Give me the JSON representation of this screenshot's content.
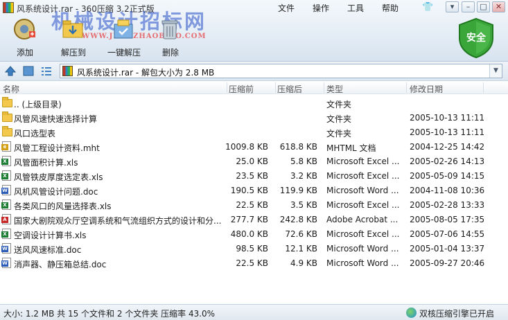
{
  "window": {
    "title": "风系统设计.rar - 360压缩 3.2正式版"
  },
  "menu": [
    "文件",
    "操作",
    "工具",
    "帮助"
  ],
  "watermark": {
    "text": "机械设计招标网",
    "url": "WWW.JIXIEZHAOBIAO.COM"
  },
  "toolbar": {
    "add": "添加",
    "extract_to": "解压到",
    "one_click_extract": "一键解压",
    "delete": "删除",
    "safe": "安全"
  },
  "address": {
    "path": "风系统设计.rar - 解包大小为 2.8 MB"
  },
  "columns": {
    "name": "名称",
    "size": "压缩前",
    "packed": "压缩后",
    "type": "类型",
    "date": "修改日期"
  },
  "files": [
    {
      "name": ".. (上级目录)",
      "size": "",
      "packed": "",
      "type": "文件夹",
      "date": "",
      "icon": "folder-icon"
    },
    {
      "name": "风管风速快速选择计算",
      "size": "",
      "packed": "",
      "type": "文件夹",
      "date": "2005-10-13 11:11",
      "icon": "folder-icon"
    },
    {
      "name": "风口选型表",
      "size": "",
      "packed": "",
      "type": "文件夹",
      "date": "2005-10-13 11:11",
      "icon": "folder-icon"
    },
    {
      "name": "风管工程设计资料.mht",
      "size": "1009.8 KB",
      "packed": "618.8 KB",
      "type": "MHTML 文档",
      "date": "2004-12-25 14:42",
      "icon": "mht-file-icon"
    },
    {
      "name": "风管面积计算.xls",
      "size": "25.0 KB",
      "packed": "5.8 KB",
      "type": "Microsoft Excel ...",
      "date": "2005-02-26 14:13",
      "icon": "excel-file-icon"
    },
    {
      "name": "风管铁皮厚度选定表.xls",
      "size": "23.5 KB",
      "packed": "3.2 KB",
      "type": "Microsoft Excel ...",
      "date": "2005-05-09 14:15",
      "icon": "excel-file-icon"
    },
    {
      "name": "风机风管设计问题.doc",
      "size": "190.5 KB",
      "packed": "119.9 KB",
      "type": "Microsoft Word ...",
      "date": "2004-11-08 10:36",
      "icon": "word-file-icon"
    },
    {
      "name": "各类风口的风量选择表.xls",
      "size": "22.5 KB",
      "packed": "3.5 KB",
      "type": "Microsoft Excel ...",
      "date": "2005-02-28 13:33",
      "icon": "excel-file-icon"
    },
    {
      "name": "国家大剧院观众厅空调系统和气流组织方式的设计和分...",
      "size": "277.7 KB",
      "packed": "242.8 KB",
      "type": "Adobe Acrobat ...",
      "date": "2005-08-05 17:35",
      "icon": "pdf-file-icon"
    },
    {
      "name": "空调设计计算书.xls",
      "size": "480.0 KB",
      "packed": "72.6 KB",
      "type": "Microsoft Excel ...",
      "date": "2005-07-06 14:55",
      "icon": "excel-file-icon"
    },
    {
      "name": "送风风速标准.doc",
      "size": "98.5 KB",
      "packed": "12.1 KB",
      "type": "Microsoft Word ...",
      "date": "2005-01-04 13:37",
      "icon": "word-file-icon"
    },
    {
      "name": "消声器、静压箱总结.doc",
      "size": "22.5 KB",
      "packed": "4.9 KB",
      "type": "Microsoft Word ...",
      "date": "2005-09-27 20:46",
      "icon": "word-file-icon"
    }
  ],
  "status": {
    "summary": "大小: 1.2 MB 共 15 个文件和 2 个文件夹 压缩率 43.0%",
    "engine": "双核压缩引擎已开启"
  },
  "colors": {
    "accent": "#3d7fc1",
    "safe_shield": "#3aa63a",
    "ribbon": "#e3ecf5"
  }
}
